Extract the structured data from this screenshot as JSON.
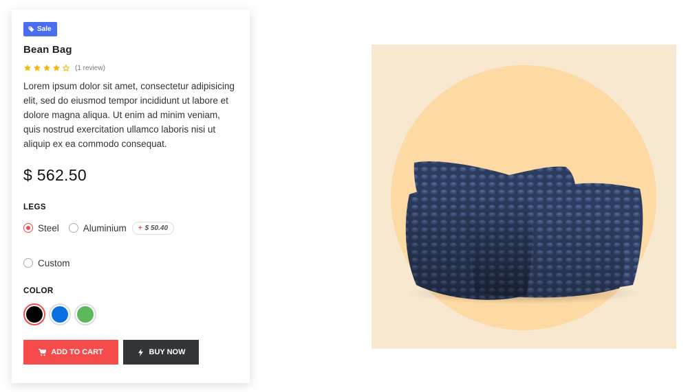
{
  "badge": {
    "label": "Sale",
    "icon": "tag-icon",
    "color": "#4b6df0"
  },
  "product": {
    "title": "Bean Bag",
    "rating": {
      "value": 4,
      "max": 5,
      "review_text": "(1 review)"
    },
    "description": "Lorem ipsum dolor sit amet, consectetur adipisicing elit, sed do eiusmod tempor incididunt ut labore et dolore magna aliqua. Ut enim ad minim veniam, quis nostrud exercitation ullamco laboris nisi ut aliquip ex ea commodo consequat.",
    "price": "$ 562.50"
  },
  "legs": {
    "label": "LEGS",
    "options": [
      {
        "label": "Steel",
        "selected": true
      },
      {
        "label": "Aluminium",
        "selected": false,
        "addon": "$ 50.40",
        "addon_sign": "+"
      },
      {
        "label": "Custom",
        "selected": false
      }
    ]
  },
  "color": {
    "label": "COLOR",
    "swatches": [
      {
        "name": "black",
        "hex": "#000000",
        "selected": true
      },
      {
        "name": "blue",
        "hex": "#0a70e0",
        "selected": false
      },
      {
        "name": "green",
        "hex": "#5cb85c",
        "selected": false
      }
    ]
  },
  "actions": {
    "add_to_cart": {
      "label": "ADD TO CART",
      "icon": "cart-icon",
      "color": "#f54b4b"
    },
    "buy_now": {
      "label": "BUY NOW",
      "icon": "bolt-icon",
      "color": "#323639"
    }
  },
  "image": {
    "panel_color": "#f8e8d0",
    "circle_color": "#fdd9a3",
    "product_color": "#2d3c5e"
  }
}
